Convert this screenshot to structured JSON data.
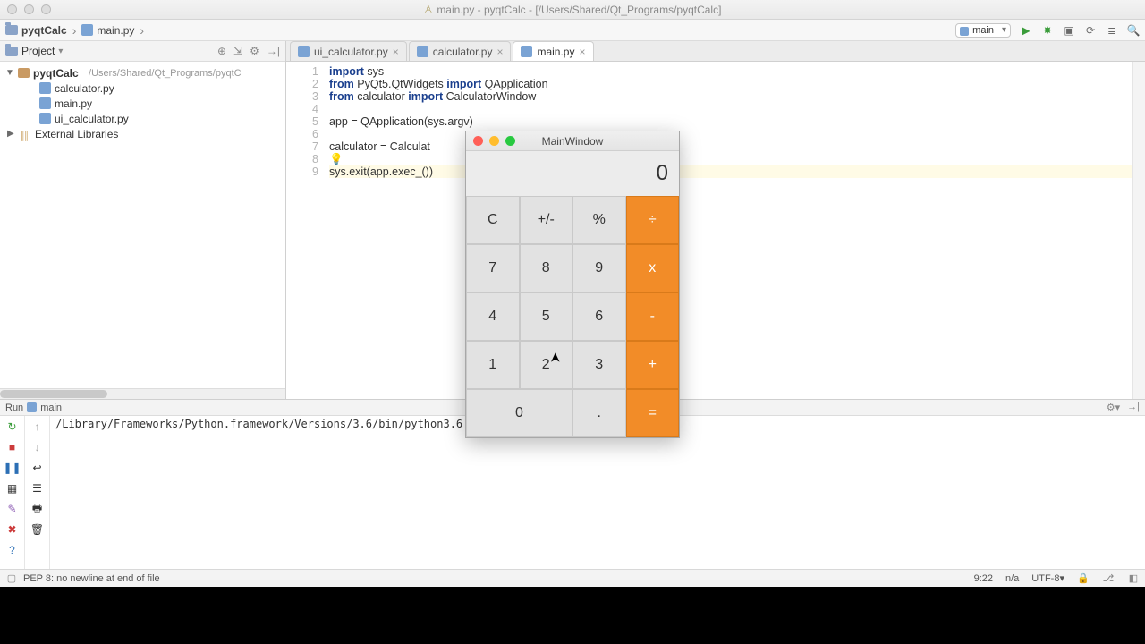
{
  "window": {
    "title": "main.py - pyqtCalc - [/Users/Shared/Qt_Programs/pyqtCalc]"
  },
  "breadcrumb": {
    "project": "pyqtCalc",
    "file": "main.py"
  },
  "run_config": {
    "selected": "main"
  },
  "toolbar_icons": {
    "run": "▶",
    "debug": "✸",
    "coverage": "▣",
    "stop": "⟳",
    "update": "≣",
    "search": "🔍"
  },
  "project_panel": {
    "title": "Project",
    "root_name": "pyqtCalc",
    "root_path": "/Users/Shared/Qt_Programs/pyqtC",
    "files": [
      {
        "name": "calculator.py"
      },
      {
        "name": "main.py"
      },
      {
        "name": "ui_calculator.py"
      }
    ],
    "external_label": "External Libraries"
  },
  "tabs": [
    {
      "label": "ui_calculator.py",
      "active": false
    },
    {
      "label": "calculator.py",
      "active": false
    },
    {
      "label": "main.py",
      "active": true
    }
  ],
  "editor": {
    "line_numbers": [
      "1",
      "2",
      "3",
      "4",
      "5",
      "6",
      "7",
      "8",
      "9"
    ],
    "lines": {
      "l1a": "import",
      "l1b": " sys",
      "l2a": "from",
      "l2b": " PyQt5.QtWidgets ",
      "l2c": "import",
      "l2d": " QApplication",
      "l3a": "from",
      "l3b": " calculator ",
      "l3c": "import",
      "l3d": " CalculatorWindow",
      "l4": "",
      "l5": "app = QApplication(sys.argv)",
      "l6": "",
      "l7": "calculator = Calculat",
      "l8_bulb": "💡",
      "l9": "sys.exit(app.exec_())"
    }
  },
  "calc": {
    "title": "MainWindow",
    "display": "0",
    "buttons": {
      "clear": "C",
      "negate": "+/-",
      "percent": "%",
      "divide": "÷",
      "seven": "7",
      "eight": "8",
      "nine": "9",
      "mult": "x",
      "four": "4",
      "five": "5",
      "six": "6",
      "minus": "-",
      "one": "1",
      "two": "2",
      "three": "3",
      "plus": "+",
      "zero": "0",
      "dot": ".",
      "equals": "="
    }
  },
  "run_panel": {
    "label_prefix": "Run",
    "label_name": "main",
    "output": "/Library/Frameworks/Python.framework/Versions/3.6/bin/python3.6                                                  /main.py"
  },
  "status": {
    "message": "PEP 8: no newline at end of file",
    "cursor": "9:22",
    "na": "n/a",
    "encoding": "UTF-8",
    "encoding_arrow": "▾",
    "lock": "🔒",
    "git": "⎇",
    "man": "◧"
  }
}
